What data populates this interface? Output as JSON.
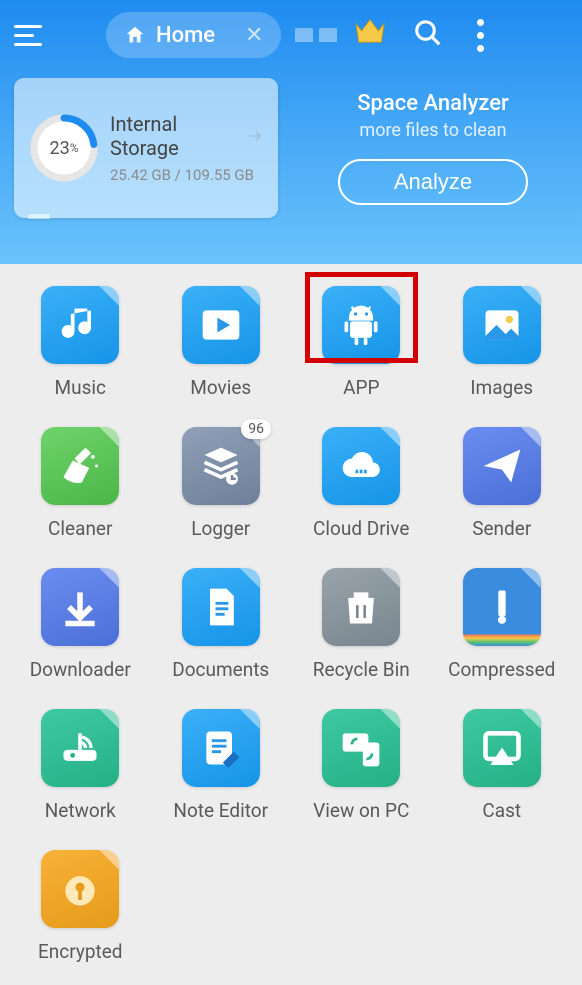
{
  "header": {
    "tab_label": "Home",
    "storage": {
      "title": "Internal Storage",
      "percent": "23",
      "percent_suffix": "%",
      "usage": "25.42 GB / 109.55 GB"
    },
    "analyzer": {
      "title": "Space Analyzer",
      "subtitle": "more files to clean",
      "button": "Analyze"
    }
  },
  "grid": {
    "items": [
      {
        "label": "Music",
        "icon": "music",
        "color": "c-blue",
        "highlight": false
      },
      {
        "label": "Movies",
        "icon": "play",
        "color": "c-blue",
        "highlight": false
      },
      {
        "label": "APP",
        "icon": "android",
        "color": "c-blue",
        "highlight": true
      },
      {
        "label": "Images",
        "icon": "image",
        "color": "c-blue",
        "highlight": false
      },
      {
        "label": "Cleaner",
        "icon": "broom",
        "color": "c-green",
        "highlight": false
      },
      {
        "label": "Logger",
        "icon": "stack",
        "color": "c-slate",
        "highlight": false,
        "badge": "96"
      },
      {
        "label": "Cloud Drive",
        "icon": "cloud",
        "color": "c-blue",
        "highlight": false
      },
      {
        "label": "Sender",
        "icon": "send",
        "color": "c-indigo",
        "highlight": false
      },
      {
        "label": "Downloader",
        "icon": "download",
        "color": "c-indigo",
        "highlight": false
      },
      {
        "label": "Documents",
        "icon": "doc",
        "color": "c-blue",
        "highlight": false
      },
      {
        "label": "Recycle Bin",
        "icon": "trash",
        "color": "c-gray",
        "highlight": false
      },
      {
        "label": "Compressed",
        "icon": "zip",
        "color": "c-zip",
        "highlight": false
      },
      {
        "label": "Network",
        "icon": "router",
        "color": "c-teal",
        "highlight": false
      },
      {
        "label": "Note Editor",
        "icon": "note",
        "color": "c-blue",
        "highlight": false
      },
      {
        "label": "View on PC",
        "icon": "pc",
        "color": "c-teal",
        "highlight": false
      },
      {
        "label": "Cast",
        "icon": "cast",
        "color": "c-teal",
        "highlight": false
      },
      {
        "label": "Encrypted",
        "icon": "lock",
        "color": "c-orange",
        "highlight": false
      }
    ]
  }
}
